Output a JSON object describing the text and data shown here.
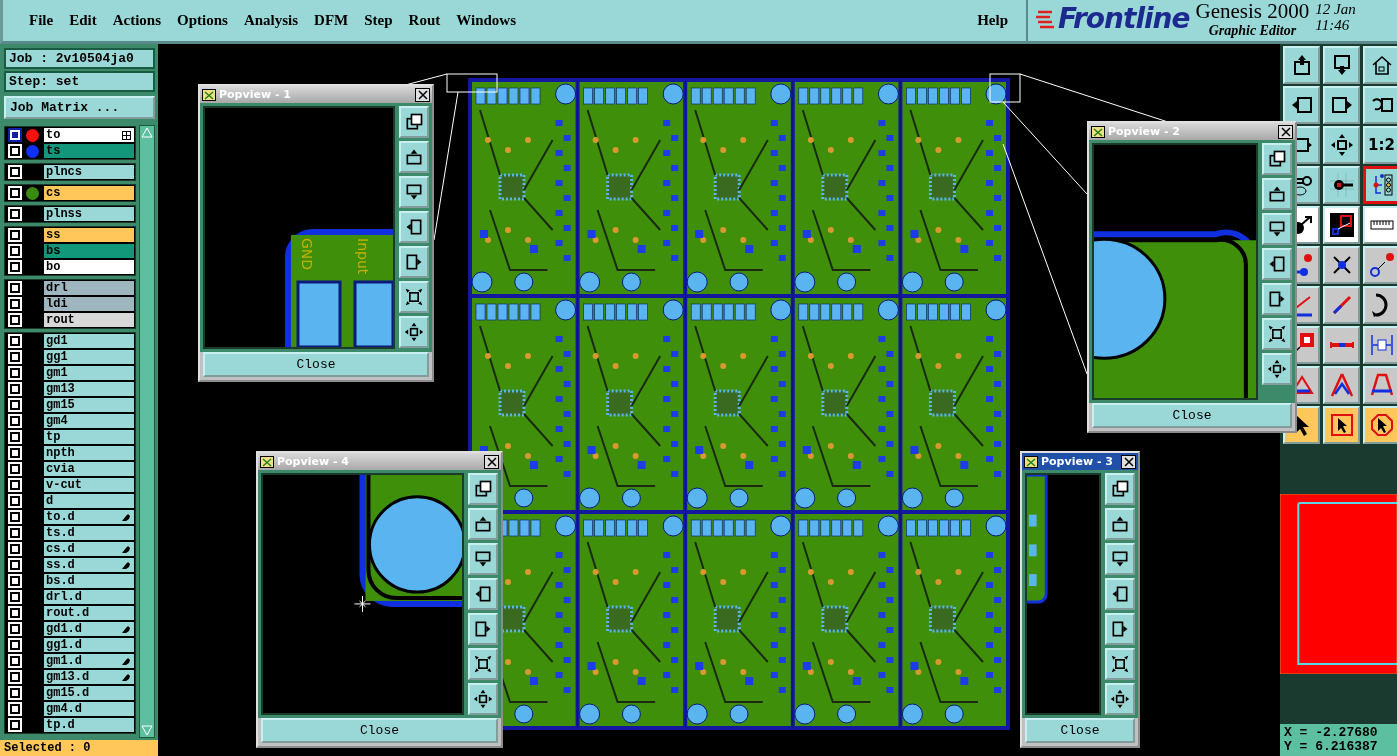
{
  "menu": [
    {
      "label": "File"
    },
    {
      "label": "Edit"
    },
    {
      "label": "Actions"
    },
    {
      "label": "Options"
    },
    {
      "label": "Analysis"
    },
    {
      "label": "DFM"
    },
    {
      "label": "Step"
    },
    {
      "label": "Rout"
    },
    {
      "label": "Windows"
    }
  ],
  "help": "Help",
  "brand": {
    "logo": "Frontline",
    "product": "Genesis 2000",
    "subtitle": "Graphic Editor",
    "date": "12 Jan",
    "time": "11:46"
  },
  "job": {
    "job": "Job : 2v10504ja0",
    "step": "Step: set",
    "matrix_button": "Job Matrix ..."
  },
  "layer_groups": [
    {
      "layers": [
        {
          "name": "to",
          "color": "#ffffff",
          "dot": {
            "color": "#ff1010"
          },
          "selected": true,
          "flagged": false
        },
        {
          "name": "ts",
          "color": "#12977a",
          "dot": {
            "color": "#1030ff"
          },
          "selected": false,
          "flagged": false
        }
      ]
    },
    {
      "layers": [
        {
          "name": "plncs",
          "color": "#9ad8d8",
          "selected": false,
          "flagged": false
        }
      ]
    },
    {
      "layers": [
        {
          "name": "cs",
          "color": "#ffc65a",
          "dot": {
            "color": "#3a8a10"
          },
          "selected": false,
          "flagged": false
        }
      ]
    },
    {
      "layers": [
        {
          "name": "plnss",
          "color": "#9ad8d8",
          "selected": false,
          "flagged": false
        }
      ]
    },
    {
      "layers": [
        {
          "name": "ss",
          "color": "#ffc65a",
          "selected": false,
          "flagged": false
        },
        {
          "name": "bs",
          "color": "#12977a",
          "selected": false,
          "flagged": false
        },
        {
          "name": "bo",
          "color": "#ffffff",
          "selected": false,
          "flagged": false
        }
      ]
    },
    {
      "layers": [
        {
          "name": "drl",
          "color": "#9fb6c0",
          "selected": false,
          "flagged": false
        },
        {
          "name": "ldi",
          "color": "#9fb6c0",
          "selected": false,
          "flagged": false
        },
        {
          "name": "rout",
          "color": "#d8d8d8",
          "selected": false,
          "flagged": false
        }
      ]
    },
    {
      "layers": [
        {
          "name": "gd1",
          "color": "#9ad8d8",
          "selected": false,
          "flagged": false
        },
        {
          "name": "gg1",
          "color": "#9ad8d8",
          "selected": false,
          "flagged": false
        },
        {
          "name": "gm1",
          "color": "#9ad8d8",
          "selected": false,
          "flagged": false
        },
        {
          "name": "gm13",
          "color": "#9ad8d8",
          "selected": false,
          "flagged": false
        },
        {
          "name": "gm15",
          "color": "#9ad8d8",
          "selected": false,
          "flagged": false
        },
        {
          "name": "gm4",
          "color": "#9ad8d8",
          "selected": false,
          "flagged": false
        },
        {
          "name": "tp",
          "color": "#9ad8d8",
          "selected": false,
          "flagged": false
        },
        {
          "name": "npth",
          "color": "#9ad8d8",
          "selected": false,
          "flagged": false
        },
        {
          "name": "cvia",
          "color": "#9ad8d8",
          "selected": false,
          "flagged": false
        },
        {
          "name": "v-cut",
          "color": "#9ad8d8",
          "selected": false,
          "flagged": false
        },
        {
          "name": "d",
          "color": "#9ad8d8",
          "selected": false,
          "flagged": false
        },
        {
          "name": "to.d",
          "color": "#9ad8d8",
          "selected": false,
          "flagged": true
        },
        {
          "name": "ts.d",
          "color": "#9ad8d8",
          "selected": false,
          "flagged": false
        },
        {
          "name": "cs.d",
          "color": "#9ad8d8",
          "selected": false,
          "flagged": true
        },
        {
          "name": "ss.d",
          "color": "#9ad8d8",
          "selected": false,
          "flagged": true
        },
        {
          "name": "bs.d",
          "color": "#9ad8d8",
          "selected": false,
          "flagged": false
        },
        {
          "name": "drl.d",
          "color": "#9ad8d8",
          "selected": false,
          "flagged": false
        },
        {
          "name": "rout.d",
          "color": "#9ad8d8",
          "selected": false,
          "flagged": false
        },
        {
          "name": "gd1.d",
          "color": "#9ad8d8",
          "selected": false,
          "flagged": true
        },
        {
          "name": "gg1.d",
          "color": "#9ad8d8",
          "selected": false,
          "flagged": false
        },
        {
          "name": "gm1.d",
          "color": "#9ad8d8",
          "selected": false,
          "flagged": true
        },
        {
          "name": "gm13.d",
          "color": "#9ad8d8",
          "selected": false,
          "flagged": true
        },
        {
          "name": "gm15.d",
          "color": "#9ad8d8",
          "selected": false,
          "flagged": false
        },
        {
          "name": "gm4.d",
          "color": "#9ad8d8",
          "selected": false,
          "flagged": false
        },
        {
          "name": "tp.d",
          "color": "#9ad8d8",
          "selected": false,
          "flagged": false
        }
      ]
    }
  ],
  "selected_count": "Selected : 0",
  "popviews": [
    {
      "title": "Popview - 1",
      "active": false,
      "kind": "pads",
      "labels": [
        "GND",
        "Input"
      ],
      "close": "Close"
    },
    {
      "title": "Popview - 2",
      "active": false,
      "kind": "circle-right",
      "close": "Close"
    },
    {
      "title": "Popview - 4",
      "active": false,
      "kind": "circle",
      "close": "Close"
    },
    {
      "title": "Popview - 3",
      "active": true,
      "kind": "edge",
      "close": "Close"
    }
  ],
  "tools": [
    {
      "selected": false
    },
    {
      "selected": false
    },
    {
      "selected": false
    },
    {
      "selected": false
    },
    {
      "selected": false
    },
    {
      "selected": false
    },
    {
      "selected": false
    },
    {
      "selected": false
    },
    {
      "selected": false,
      "label": "1:2"
    },
    {
      "selected": false
    },
    {
      "selected": false
    },
    {
      "selected": true
    },
    {
      "selected": false
    },
    {
      "selected": false
    },
    {
      "selected": false
    },
    {
      "selected": false
    },
    {
      "selected": false
    },
    {
      "selected": false
    },
    {
      "selected": false
    },
    {
      "selected": false
    },
    {
      "selected": false
    },
    {
      "selected": false
    },
    {
      "selected": false
    },
    {
      "selected": false
    },
    {
      "selected": false
    },
    {
      "selected": false
    },
    {
      "selected": false
    },
    {
      "selected": false
    },
    {
      "selected": false
    },
    {
      "selected": false
    }
  ],
  "coords": {
    "x": "X = -2.27680",
    "y": "Y = 6.216387"
  }
}
